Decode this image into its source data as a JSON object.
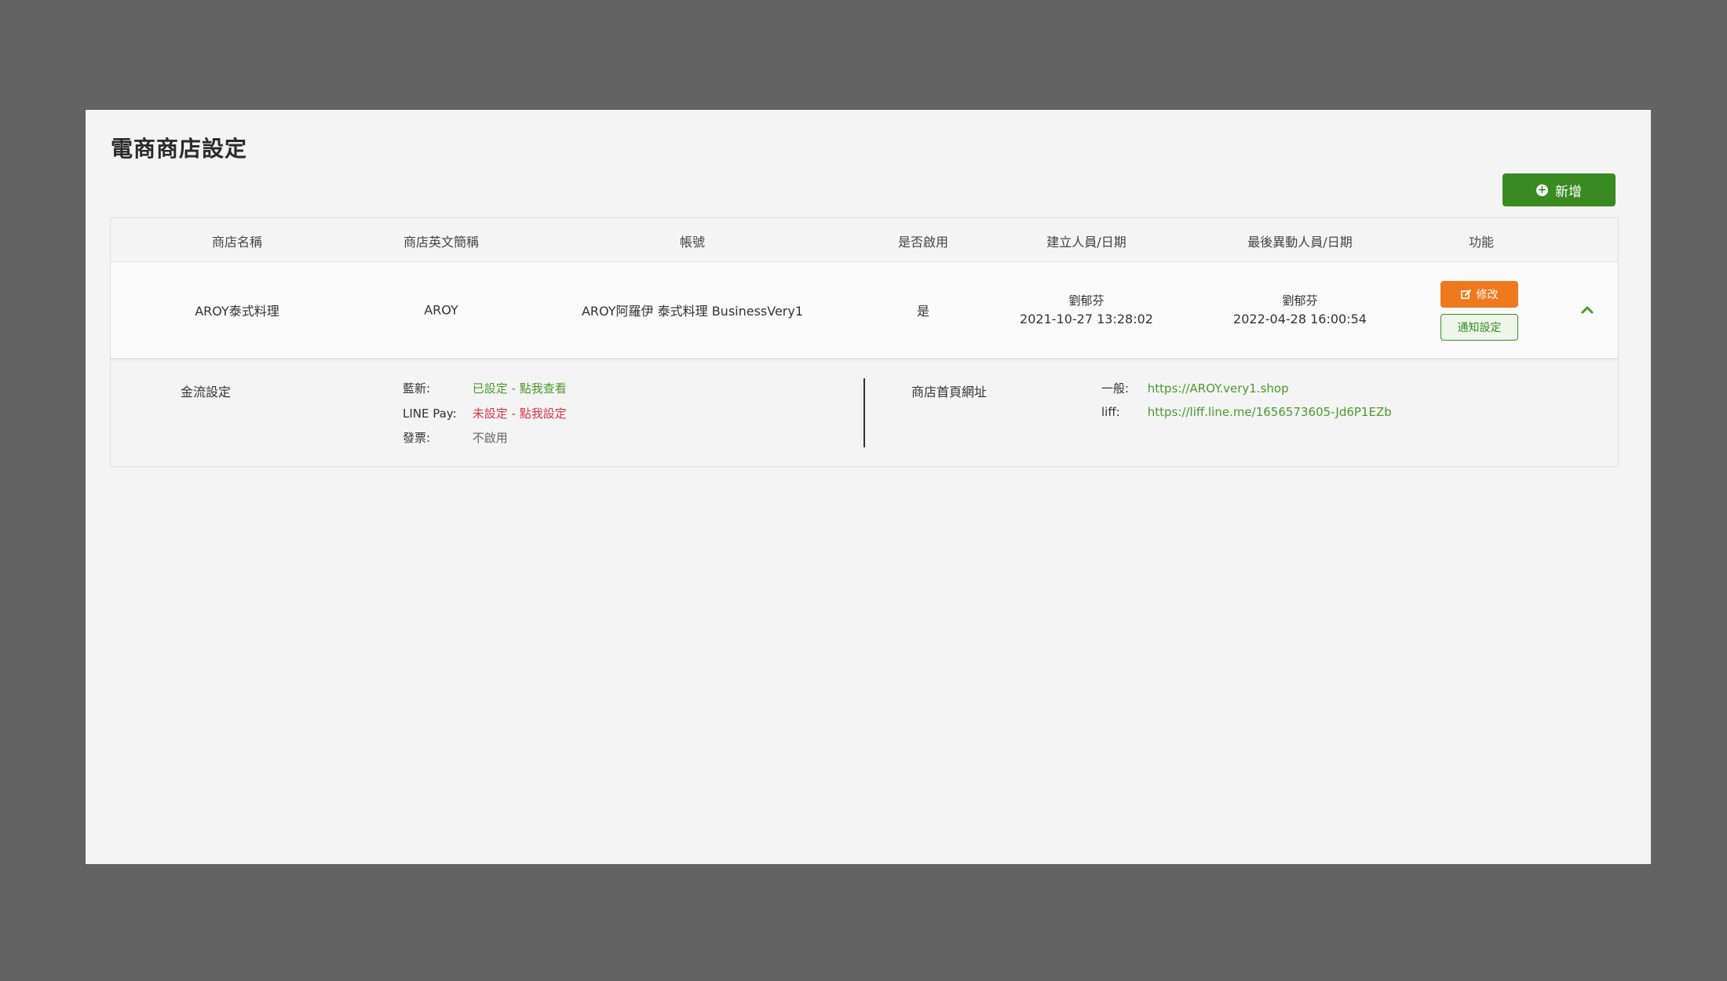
{
  "page": {
    "title": "電商商店設定",
    "add_label": "新增"
  },
  "table": {
    "headers": {
      "store_name": "商店名稱",
      "store_en": "商店英文簡稱",
      "account": "帳號",
      "enabled": "是否啟用",
      "created": "建立人員/日期",
      "modified": "最後異動人員/日期",
      "actions": "功能"
    },
    "row": {
      "store_name": "AROY泰式料理",
      "store_en": "AROY",
      "account": "AROY阿羅伊 泰式料理 BusinessVery1",
      "enabled": "是",
      "created_by": "劉郁芬",
      "created_at": "2021-10-27 13:28:02",
      "modified_by": "劉郁芬",
      "modified_at": "2022-04-28 16:00:54",
      "edit_label": "修改",
      "notify_label": "通知設定"
    },
    "detail": {
      "payment_title": "金流設定",
      "payments": [
        {
          "key": "藍新:",
          "value": "已設定 - 點我查看",
          "status": "set"
        },
        {
          "key": "LINE Pay:",
          "value": "未設定 - 點我設定",
          "status": "unset"
        },
        {
          "key": "發票:",
          "value": "不啟用",
          "status": "disabled"
        }
      ],
      "url_title": "商店首頁網址",
      "urls": [
        {
          "key": "一般:",
          "value": "https://AROY.very1.shop"
        },
        {
          "key": "liff:",
          "value": "https://liff.line.me/1656573605-Jd6P1EZb"
        }
      ]
    }
  },
  "colors": {
    "add_button": "#3a8a22",
    "edit_button": "#ef7a1e",
    "link_green": "#4a9a2c",
    "warning_red": "#d8344a",
    "background": "#636363",
    "panel": "#f4f4f4"
  },
  "icons": {
    "add": "plus-circle-icon",
    "edit": "edit-icon",
    "collapse": "chevron-up-icon"
  }
}
